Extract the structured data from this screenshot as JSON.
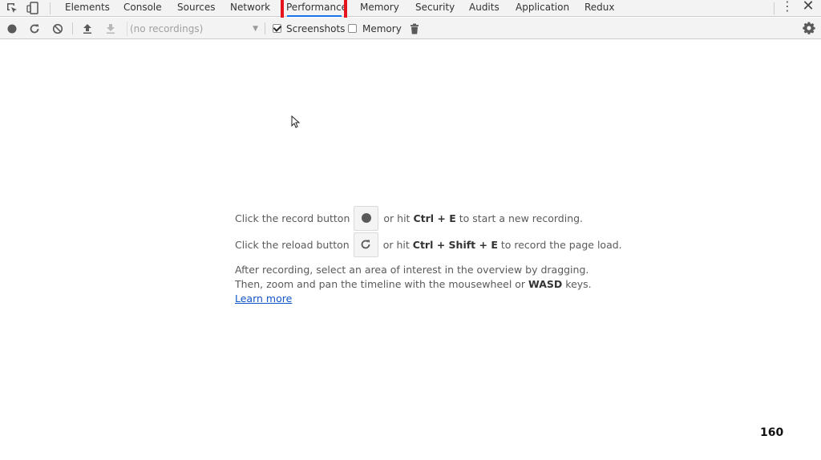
{
  "tabbar": {
    "tabs": [
      {
        "label": "Elements"
      },
      {
        "label": "Console"
      },
      {
        "label": "Sources"
      },
      {
        "label": "Network"
      },
      {
        "label": "Performance",
        "active": true
      },
      {
        "label": "Memory"
      },
      {
        "label": "Security"
      },
      {
        "label": "Audits"
      },
      {
        "label": "Application"
      },
      {
        "label": "Redux"
      }
    ],
    "menu_icon": "⋮",
    "close_icon": "✕",
    "highlight_color": "#e8141c",
    "active_underline_color": "#1a73e8"
  },
  "toolbar": {
    "recordings_placeholder": "(no recordings)",
    "screenshots_label": "Screenshots",
    "screenshots_checked": true,
    "memory_label": "Memory",
    "memory_checked": false
  },
  "landing": {
    "record_pre": "Click the record button",
    "record_post_1": "or hit ",
    "record_shortcut": "Ctrl + E",
    "record_post_2": " to start a new recording.",
    "reload_pre": "Click the reload button",
    "reload_post_1": "or hit ",
    "reload_shortcut": "Ctrl + Shift + E",
    "reload_post_2": " to record the page load.",
    "para_line1": "After recording, select an area of interest in the overview by dragging.",
    "para_line2_pre": "Then, zoom and pan the timeline with the mousewheel or ",
    "para_line2_key": "WASD",
    "para_line2_post": " keys.",
    "learn_more": "Learn more"
  },
  "page_number": "160"
}
